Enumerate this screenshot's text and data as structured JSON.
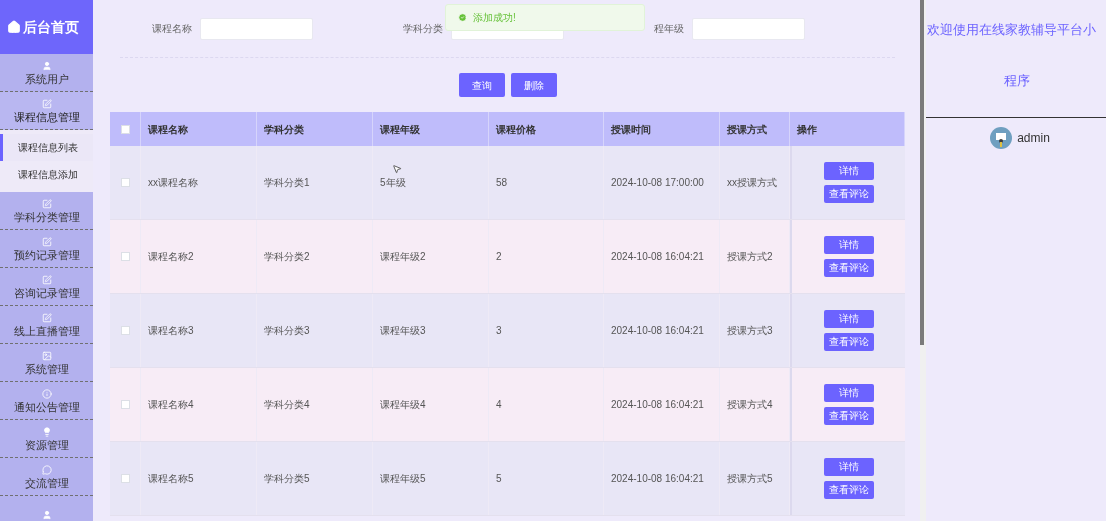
{
  "sidebar": {
    "title": "后台首页",
    "items": [
      {
        "label": "系统用户",
        "expanded": false
      },
      {
        "label": "课程信息管理",
        "expanded": true,
        "children": [
          {
            "label": "课程信息列表",
            "selected": true
          },
          {
            "label": "课程信息添加",
            "selected": false
          }
        ]
      },
      {
        "label": "学科分类管理",
        "expanded": false
      },
      {
        "label": "预约记录管理",
        "expanded": false
      },
      {
        "label": "咨询记录管理",
        "expanded": false
      },
      {
        "label": "线上直播管理",
        "expanded": false
      },
      {
        "label": "系统管理",
        "expanded": false
      },
      {
        "label": "通知公告管理",
        "expanded": false
      },
      {
        "label": "资源管理",
        "expanded": false
      },
      {
        "label": "交流管理",
        "expanded": false
      },
      {
        "expanded": false
      }
    ]
  },
  "search": {
    "fields": [
      {
        "label": "课程名称"
      },
      {
        "label": "学科分类"
      },
      {
        "label": "程年级"
      }
    ],
    "buttons": [
      "查询",
      "删除"
    ]
  },
  "toast": {
    "message": "添加成功!"
  },
  "table": {
    "all_checked": false,
    "columns": [
      "课程名称",
      "学科分类",
      "课程年级",
      "课程价格",
      "授课时间",
      "授课方式",
      "操作"
    ],
    "rows": [
      {
        "checked": false,
        "cells": [
          "xx课程名称",
          "学科分类1",
          "5年级",
          "58",
          "2024-10-08 17:00:00",
          "xx授课方式"
        ],
        "actions": [
          "详情",
          "查看评论"
        ]
      },
      {
        "checked": false,
        "cells": [
          "课程名称2",
          "学科分类2",
          "课程年级2",
          "2",
          "2024-10-08 16:04:21",
          "授课方式2"
        ],
        "actions": [
          "详情",
          "查看评论"
        ]
      },
      {
        "checked": false,
        "cells": [
          "课程名称3",
          "学科分类3",
          "课程年级3",
          "3",
          "2024-10-08 16:04:21",
          "授课方式3"
        ],
        "actions": [
          "详情",
          "查看评论"
        ]
      },
      {
        "checked": false,
        "cells": [
          "课程名称4",
          "学科分类4",
          "课程年级4",
          "4",
          "2024-10-08 16:04:21",
          "授课方式4"
        ],
        "actions": [
          "详情",
          "查看评论"
        ]
      },
      {
        "checked": false,
        "cells": [
          "课程名称5",
          "学科分类5",
          "课程年级5",
          "5",
          "2024-10-08 16:04:21",
          "授课方式5"
        ],
        "actions": [
          "详情",
          "查看评论"
        ]
      }
    ]
  },
  "header": {
    "title_lines": [
      "欢迎使用在线家教辅导平台小",
      "程序"
    ],
    "user": "admin"
  }
}
